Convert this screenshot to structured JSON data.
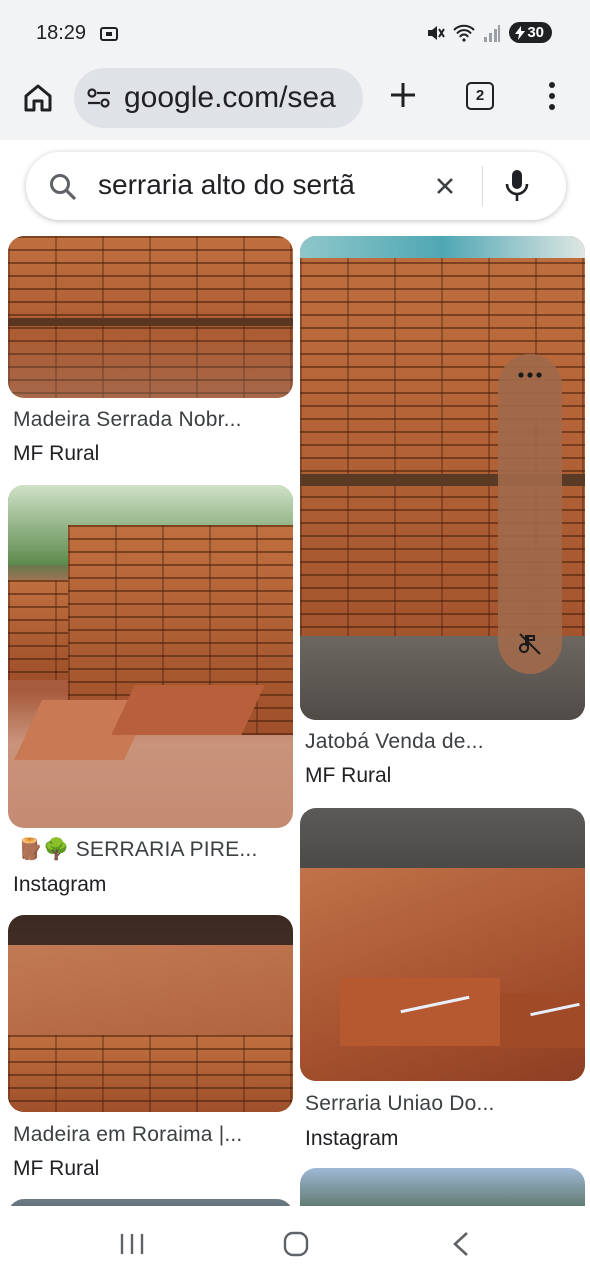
{
  "status_bar": {
    "time": "18:29",
    "battery": "30"
  },
  "browser": {
    "url": "google.com/sea",
    "tab_count": "2"
  },
  "search": {
    "query": "serraria alto do sertã"
  },
  "results": [
    {
      "caption": "Madeira Serrada Nobr...",
      "source": "MF Rural"
    },
    {
      "caption": "Jatobá Venda de...",
      "source": "MF Rural"
    },
    {
      "caption": "🪵🌳 SERRARIA PIRE...",
      "source": "Instagram"
    },
    {
      "caption": "Serraria Uniao Do...",
      "source": "Instagram"
    },
    {
      "caption": "Madeira em Roraima |...",
      "source": "MF Rural"
    }
  ],
  "colors": {
    "chrome_bg": "#f1f3f4",
    "url_pill": "#dfe3e8",
    "wood": "#b5623a"
  },
  "icons": {
    "home": "home-icon",
    "site_settings": "tune-icon",
    "new_tab": "plus-icon",
    "tabs": "tab-switcher-icon",
    "menu": "more-vert-icon",
    "search": "search-icon",
    "clear": "close-icon",
    "voice": "mic-icon"
  }
}
